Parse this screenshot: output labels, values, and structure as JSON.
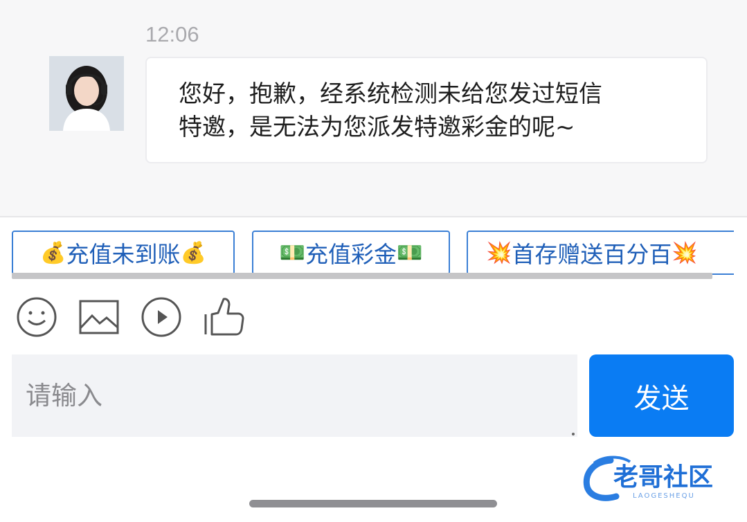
{
  "chat": {
    "timestamp": "12:06",
    "message_line1": "您好，抱歉，经系统检测未给您发过短信",
    "message_line2": "特邀，是无法为您派发特邀彩金的呢~"
  },
  "quick_replies": [
    {
      "emoji": "💰",
      "label": "充值未到账"
    },
    {
      "emoji": "💵",
      "label": "充值彩金"
    },
    {
      "emoji": "💥",
      "label": "首存赠送百分百"
    }
  ],
  "toolbar": {
    "icons": [
      "emoji-icon",
      "image-icon",
      "video-icon",
      "thumbs-up-icon"
    ]
  },
  "composer": {
    "placeholder": "请输入",
    "send_label": "发送"
  },
  "watermark": {
    "title": "老哥社区",
    "subtitle": "LAOGESHEQU"
  },
  "colors": {
    "accent": "#0a7cf3",
    "quick_border": "#3a7fd5",
    "quick_text": "#1f5fb8"
  }
}
